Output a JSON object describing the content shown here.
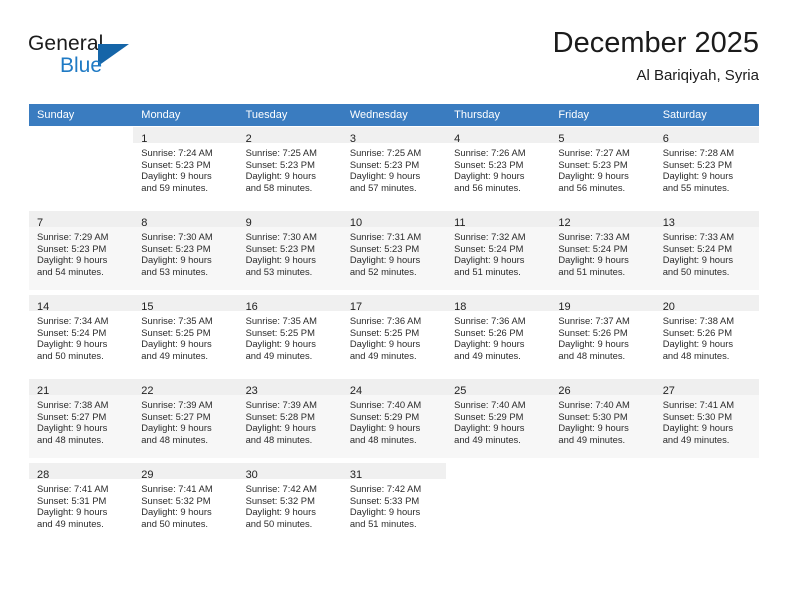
{
  "brand": {
    "name_top": "General",
    "name_bottom": "Blue",
    "triangle_color": "#1565a8",
    "blue_text_color": "#1f7ac4"
  },
  "header": {
    "title": "December 2025",
    "subtitle": "Al Bariqiyah, Syria"
  },
  "theme": {
    "header_row_bg": "#3a7cc0",
    "header_row_text": "#ffffff",
    "alt_row_bg": "#f7f7f7",
    "daynum_bar_bg": "#efefef"
  },
  "calendar": {
    "weekday_headers": [
      "Sunday",
      "Monday",
      "Tuesday",
      "Wednesday",
      "Thursday",
      "Friday",
      "Saturday"
    ],
    "weeks": [
      [
        {
          "day": "",
          "sunrise": "",
          "sunset": "",
          "daylight_line1": "",
          "daylight_line2": ""
        },
        {
          "day": "1",
          "sunrise": "Sunrise: 7:24 AM",
          "sunset": "Sunset: 5:23 PM",
          "daylight_line1": "Daylight: 9 hours",
          "daylight_line2": "and 59 minutes."
        },
        {
          "day": "2",
          "sunrise": "Sunrise: 7:25 AM",
          "sunset": "Sunset: 5:23 PM",
          "daylight_line1": "Daylight: 9 hours",
          "daylight_line2": "and 58 minutes."
        },
        {
          "day": "3",
          "sunrise": "Sunrise: 7:25 AM",
          "sunset": "Sunset: 5:23 PM",
          "daylight_line1": "Daylight: 9 hours",
          "daylight_line2": "and 57 minutes."
        },
        {
          "day": "4",
          "sunrise": "Sunrise: 7:26 AM",
          "sunset": "Sunset: 5:23 PM",
          "daylight_line1": "Daylight: 9 hours",
          "daylight_line2": "and 56 minutes."
        },
        {
          "day": "5",
          "sunrise": "Sunrise: 7:27 AM",
          "sunset": "Sunset: 5:23 PM",
          "daylight_line1": "Daylight: 9 hours",
          "daylight_line2": "and 56 minutes."
        },
        {
          "day": "6",
          "sunrise": "Sunrise: 7:28 AM",
          "sunset": "Sunset: 5:23 PM",
          "daylight_line1": "Daylight: 9 hours",
          "daylight_line2": "and 55 minutes."
        }
      ],
      [
        {
          "day": "7",
          "sunrise": "Sunrise: 7:29 AM",
          "sunset": "Sunset: 5:23 PM",
          "daylight_line1": "Daylight: 9 hours",
          "daylight_line2": "and 54 minutes."
        },
        {
          "day": "8",
          "sunrise": "Sunrise: 7:30 AM",
          "sunset": "Sunset: 5:23 PM",
          "daylight_line1": "Daylight: 9 hours",
          "daylight_line2": "and 53 minutes."
        },
        {
          "day": "9",
          "sunrise": "Sunrise: 7:30 AM",
          "sunset": "Sunset: 5:23 PM",
          "daylight_line1": "Daylight: 9 hours",
          "daylight_line2": "and 53 minutes."
        },
        {
          "day": "10",
          "sunrise": "Sunrise: 7:31 AM",
          "sunset": "Sunset: 5:23 PM",
          "daylight_line1": "Daylight: 9 hours",
          "daylight_line2": "and 52 minutes."
        },
        {
          "day": "11",
          "sunrise": "Sunrise: 7:32 AM",
          "sunset": "Sunset: 5:24 PM",
          "daylight_line1": "Daylight: 9 hours",
          "daylight_line2": "and 51 minutes."
        },
        {
          "day": "12",
          "sunrise": "Sunrise: 7:33 AM",
          "sunset": "Sunset: 5:24 PM",
          "daylight_line1": "Daylight: 9 hours",
          "daylight_line2": "and 51 minutes."
        },
        {
          "day": "13",
          "sunrise": "Sunrise: 7:33 AM",
          "sunset": "Sunset: 5:24 PM",
          "daylight_line1": "Daylight: 9 hours",
          "daylight_line2": "and 50 minutes."
        }
      ],
      [
        {
          "day": "14",
          "sunrise": "Sunrise: 7:34 AM",
          "sunset": "Sunset: 5:24 PM",
          "daylight_line1": "Daylight: 9 hours",
          "daylight_line2": "and 50 minutes."
        },
        {
          "day": "15",
          "sunrise": "Sunrise: 7:35 AM",
          "sunset": "Sunset: 5:25 PM",
          "daylight_line1": "Daylight: 9 hours",
          "daylight_line2": "and 49 minutes."
        },
        {
          "day": "16",
          "sunrise": "Sunrise: 7:35 AM",
          "sunset": "Sunset: 5:25 PM",
          "daylight_line1": "Daylight: 9 hours",
          "daylight_line2": "and 49 minutes."
        },
        {
          "day": "17",
          "sunrise": "Sunrise: 7:36 AM",
          "sunset": "Sunset: 5:25 PM",
          "daylight_line1": "Daylight: 9 hours",
          "daylight_line2": "and 49 minutes."
        },
        {
          "day": "18",
          "sunrise": "Sunrise: 7:36 AM",
          "sunset": "Sunset: 5:26 PM",
          "daylight_line1": "Daylight: 9 hours",
          "daylight_line2": "and 49 minutes."
        },
        {
          "day": "19",
          "sunrise": "Sunrise: 7:37 AM",
          "sunset": "Sunset: 5:26 PM",
          "daylight_line1": "Daylight: 9 hours",
          "daylight_line2": "and 48 minutes."
        },
        {
          "day": "20",
          "sunrise": "Sunrise: 7:38 AM",
          "sunset": "Sunset: 5:26 PM",
          "daylight_line1": "Daylight: 9 hours",
          "daylight_line2": "and 48 minutes."
        }
      ],
      [
        {
          "day": "21",
          "sunrise": "Sunrise: 7:38 AM",
          "sunset": "Sunset: 5:27 PM",
          "daylight_line1": "Daylight: 9 hours",
          "daylight_line2": "and 48 minutes."
        },
        {
          "day": "22",
          "sunrise": "Sunrise: 7:39 AM",
          "sunset": "Sunset: 5:27 PM",
          "daylight_line1": "Daylight: 9 hours",
          "daylight_line2": "and 48 minutes."
        },
        {
          "day": "23",
          "sunrise": "Sunrise: 7:39 AM",
          "sunset": "Sunset: 5:28 PM",
          "daylight_line1": "Daylight: 9 hours",
          "daylight_line2": "and 48 minutes."
        },
        {
          "day": "24",
          "sunrise": "Sunrise: 7:40 AM",
          "sunset": "Sunset: 5:29 PM",
          "daylight_line1": "Daylight: 9 hours",
          "daylight_line2": "and 48 minutes."
        },
        {
          "day": "25",
          "sunrise": "Sunrise: 7:40 AM",
          "sunset": "Sunset: 5:29 PM",
          "daylight_line1": "Daylight: 9 hours",
          "daylight_line2": "and 49 minutes."
        },
        {
          "day": "26",
          "sunrise": "Sunrise: 7:40 AM",
          "sunset": "Sunset: 5:30 PM",
          "daylight_line1": "Daylight: 9 hours",
          "daylight_line2": "and 49 minutes."
        },
        {
          "day": "27",
          "sunrise": "Sunrise: 7:41 AM",
          "sunset": "Sunset: 5:30 PM",
          "daylight_line1": "Daylight: 9 hours",
          "daylight_line2": "and 49 minutes."
        }
      ],
      [
        {
          "day": "28",
          "sunrise": "Sunrise: 7:41 AM",
          "sunset": "Sunset: 5:31 PM",
          "daylight_line1": "Daylight: 9 hours",
          "daylight_line2": "and 49 minutes."
        },
        {
          "day": "29",
          "sunrise": "Sunrise: 7:41 AM",
          "sunset": "Sunset: 5:32 PM",
          "daylight_line1": "Daylight: 9 hours",
          "daylight_line2": "and 50 minutes."
        },
        {
          "day": "30",
          "sunrise": "Sunrise: 7:42 AM",
          "sunset": "Sunset: 5:32 PM",
          "daylight_line1": "Daylight: 9 hours",
          "daylight_line2": "and 50 minutes."
        },
        {
          "day": "31",
          "sunrise": "Sunrise: 7:42 AM",
          "sunset": "Sunset: 5:33 PM",
          "daylight_line1": "Daylight: 9 hours",
          "daylight_line2": "and 51 minutes."
        },
        {
          "day": "",
          "sunrise": "",
          "sunset": "",
          "daylight_line1": "",
          "daylight_line2": ""
        },
        {
          "day": "",
          "sunrise": "",
          "sunset": "",
          "daylight_line1": "",
          "daylight_line2": ""
        },
        {
          "day": "",
          "sunrise": "",
          "sunset": "",
          "daylight_line1": "",
          "daylight_line2": ""
        }
      ]
    ]
  }
}
